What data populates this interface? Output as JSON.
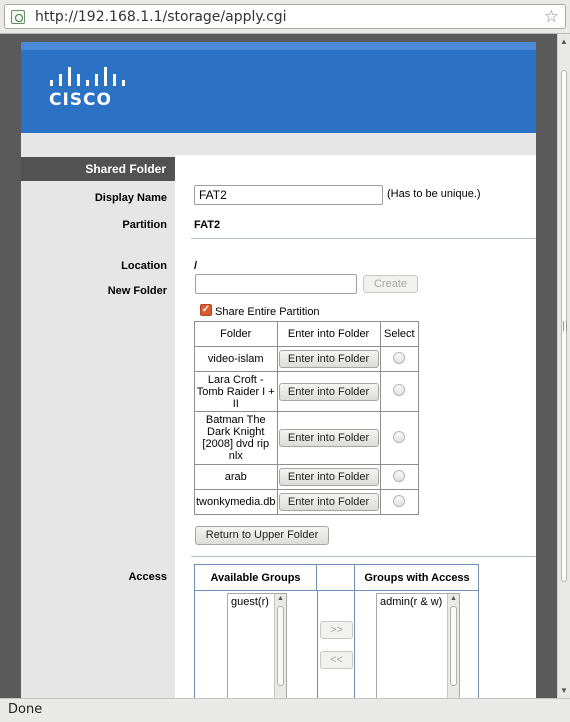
{
  "browser": {
    "url": "http://192.168.1.1/storage/apply.cgi",
    "status": "Done"
  },
  "brand": {
    "logo_text": "CISCO"
  },
  "form": {
    "section_title": "Shared Folder",
    "display_name_label": "Display Name",
    "display_name_value": "FAT2",
    "display_name_hint": "(Has to be unique.)",
    "partition_label": "Partition",
    "partition_value": "FAT2",
    "location_label": "Location",
    "location_value": "/",
    "new_folder_label": "New Folder",
    "new_folder_value": "",
    "create_button": "Create",
    "share_entire_label": "Share Entire Partition",
    "share_entire_checked": true,
    "return_button": "Return to Upper Folder"
  },
  "folder_table": {
    "headers": [
      "Folder",
      "Enter into Folder",
      "Select"
    ],
    "rows": [
      {
        "name": "video-islam",
        "button": "Enter into Folder"
      },
      {
        "name": "Lara Croft - Tomb Raider I + II",
        "button": "Enter into Folder"
      },
      {
        "name": "Batman The Dark Knight [2008] dvd rip nlx",
        "button": "Enter into Folder"
      },
      {
        "name": "arab",
        "button": "Enter into Folder"
      },
      {
        "name": "twonkymedia.db",
        "button": "Enter into Folder"
      }
    ]
  },
  "access": {
    "label": "Access",
    "available_header": "Available Groups",
    "with_access_header": "Groups with Access",
    "available_items": [
      "guest(r)"
    ],
    "with_access_items": [
      "admin(r & w)"
    ],
    "add_button": ">>",
    "remove_button": "<<"
  },
  "colors": {
    "banner": "#2c72c4",
    "section_head": "#525252",
    "sidebar": "#e6e6e6",
    "checkbox": "#d95b31"
  }
}
